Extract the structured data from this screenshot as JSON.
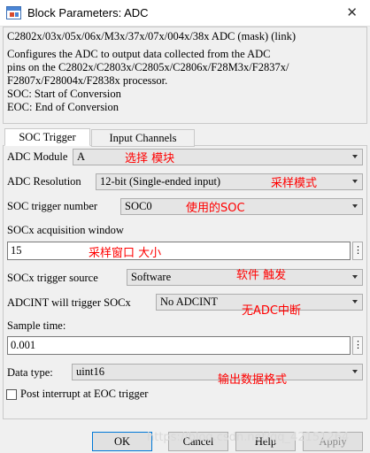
{
  "window": {
    "title": "Block Parameters: ADC",
    "close_glyph": "✕"
  },
  "mask": {
    "title": "C2802x/03x/05x/06x/M3x/37x/07x/004x/38x ADC (mask) (link)",
    "description": "Configures the ADC to output data collected from the ADC\npins on the C2802x/C2803x/C2805x/C2806x/F28M3x/F2837x/\nF2807x/F28004x/F2838x processor.\nSOC: Start of Conversion\nEOC: End of Conversion"
  },
  "tabs": [
    {
      "label": "SOC Trigger",
      "active": true
    },
    {
      "label": "Input Channels",
      "active": false
    }
  ],
  "params": {
    "adc_module": {
      "label": "ADC Module",
      "value": "A",
      "annotation": "选择 模块"
    },
    "adc_resolution": {
      "label": "ADC Resolution",
      "value": "12-bit (Single-ended input)",
      "annotation": "采样模式"
    },
    "soc_trigger_number": {
      "label": "SOC trigger number",
      "value": "SOC0",
      "annotation": "使用的SOC"
    },
    "acq_window": {
      "label": "SOCx acquisition window",
      "value": "15",
      "annotation": "采样窗口 大小"
    },
    "trigger_source": {
      "label": "SOCx trigger source",
      "value": "Software",
      "annotation": "软件 触发"
    },
    "adcint": {
      "label": "ADCINT will trigger SOCx",
      "value": "No ADCINT",
      "annotation": "无ADC中断"
    },
    "sample_time": {
      "label": "Sample time:",
      "value": "0.001"
    },
    "data_type": {
      "label": "Data type:",
      "value": "uint16",
      "annotation": "输出数据格式"
    },
    "post_interrupt": {
      "label": "Post interrupt at EOC trigger",
      "checked": false
    }
  },
  "dots_glyph": "⋮",
  "buttons": {
    "ok": "OK",
    "cancel": "Cancel",
    "help": "Help",
    "apply": "Apply"
  },
  "watermark": "https://blog.csdn.net/qq_42151264"
}
